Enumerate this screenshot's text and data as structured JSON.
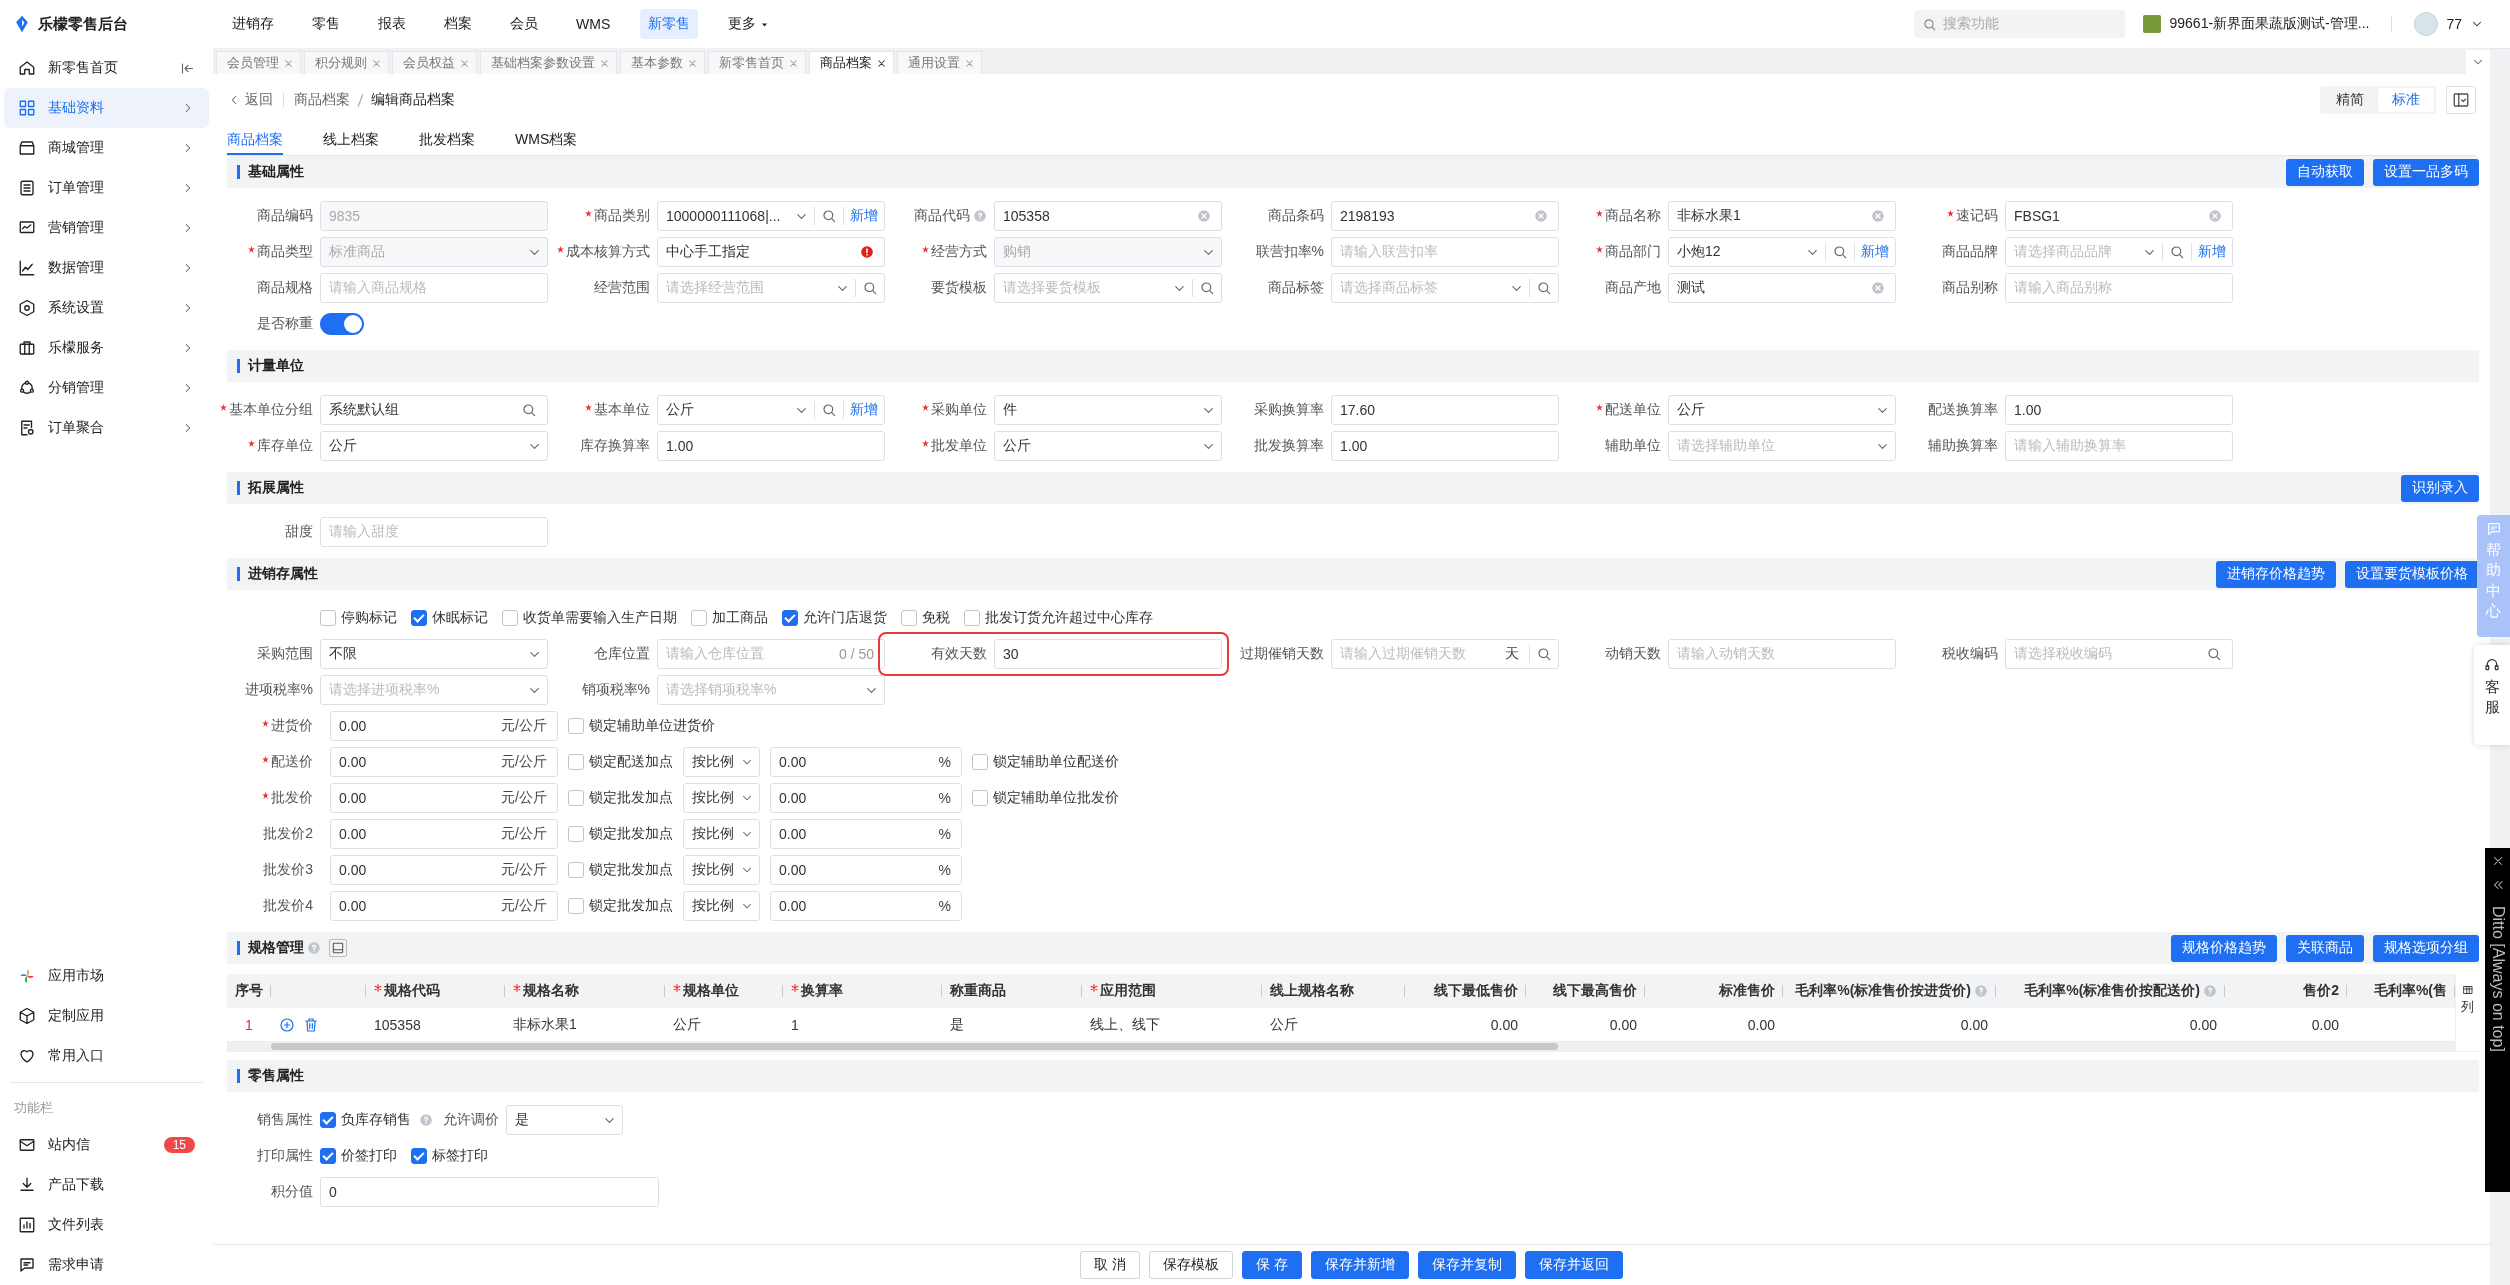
{
  "topbar": {
    "app_title": "乐檬零售后台",
    "nav": [
      {
        "label": "进销存",
        "selected": false
      },
      {
        "label": "零售",
        "selected": false
      },
      {
        "label": "报表",
        "selected": false
      },
      {
        "label": "档案",
        "selected": false
      },
      {
        "label": "会员",
        "selected": false
      },
      {
        "label": "WMS",
        "selected": false
      },
      {
        "label": "新零售",
        "selected": true
      },
      {
        "label": "更多",
        "selected": false,
        "caret": true
      }
    ],
    "search": {
      "placeholder": "搜索功能"
    },
    "store": "99661-新界面果蔬版测试-管理...",
    "user": "77"
  },
  "sidebar": {
    "items": [
      {
        "label": "新零售首页",
        "selected": false
      },
      {
        "label": "基础资料",
        "selected": true
      },
      {
        "label": "商城管理",
        "selected": false
      },
      {
        "label": "订单管理",
        "selected": false
      },
      {
        "label": "营销管理",
        "selected": false
      },
      {
        "label": "数据管理",
        "selected": false
      },
      {
        "label": "系统设置",
        "selected": false
      },
      {
        "label": "乐檬服务",
        "selected": false
      },
      {
        "label": "分销管理",
        "selected": false
      },
      {
        "label": "订单聚合",
        "selected": false
      }
    ],
    "apps": [
      {
        "label": "应用市场"
      },
      {
        "label": "定制应用"
      },
      {
        "label": "常用入口"
      }
    ],
    "function_bar": {
      "title": "功能栏",
      "items": [
        {
          "label": "站内信",
          "badge": "15"
        },
        {
          "label": "产品下载"
        },
        {
          "label": "文件列表"
        },
        {
          "label": "需求申请"
        }
      ]
    }
  },
  "page_tabs": [
    {
      "label": "会员管理",
      "selected": false
    },
    {
      "label": "积分规则",
      "selected": false
    },
    {
      "label": "会员权益",
      "selected": false
    },
    {
      "label": "基础档案参数设置",
      "selected": false
    },
    {
      "label": "基本参数",
      "selected": false
    },
    {
      "label": "新零售首页",
      "selected": false
    },
    {
      "label": "商品档案",
      "selected": true
    },
    {
      "label": "通用设置",
      "selected": false
    }
  ],
  "header": {
    "back": "返回",
    "breadcrumb": [
      "商品档案",
      "编辑商品档案"
    ],
    "views": [
      {
        "label": "精简",
        "selected": false
      },
      {
        "label": "标准",
        "selected": true
      }
    ],
    "tabs": [
      {
        "label": "商品档案",
        "selected": true
      },
      {
        "label": "线上档案",
        "selected": false
      },
      {
        "label": "批发档案",
        "selected": false
      },
      {
        "label": "WMS档案",
        "selected": false
      }
    ]
  },
  "sections": [
    {
      "title": "基础属性",
      "kind": "form",
      "buttons": [
        "自动获取",
        "设置一品多码"
      ],
      "rows": [
        {
          "kind": "grid",
          "fields": [
            {
              "label": "商品编码",
              "required": false,
              "kind": "input",
              "value": "9835",
              "disabled": true
            },
            {
              "label": "商品类别",
              "required": true,
              "kind": "select",
              "value": "1000000111068|...",
              "disabled": false,
              "search_button": true,
              "add": "新增"
            },
            {
              "label": "商品代码",
              "required": false,
              "help": true,
              "kind": "input",
              "value": "105358",
              "disabled": false,
              "clearable": true
            },
            {
              "label": "商品条码",
              "required": false,
              "kind": "input",
              "value": "2198193",
              "disabled": false,
              "clearable": true
            },
            {
              "label": "商品名称",
              "required": true,
              "kind": "input",
              "value": "非标水果1",
              "disabled": false,
              "clearable": true
            },
            {
              "label": "速记码",
              "required": true,
              "kind": "input",
              "value": "FBSG1",
              "disabled": false,
              "clearable": true
            }
          ]
        },
        {
          "kind": "grid",
          "fields": [
            {
              "label": "商品类型",
              "required": true,
              "kind": "select",
              "value": "标准商品",
              "disabled": true
            },
            {
              "label": "成本核算方式",
              "required": true,
              "kind": "input",
              "value": "中心手工指定",
              "disabled": false,
              "error": true
            },
            {
              "label": "经营方式",
              "required": true,
              "kind": "select",
              "value": "购销",
              "disabled": true
            },
            {
              "label": "联营扣率%",
              "required": false,
              "kind": "input",
              "placeholder": "请输入联营扣率",
              "disabled": false
            },
            {
              "label": "商品部门",
              "required": true,
              "kind": "select",
              "value": "小炮12",
              "disabled": false,
              "search_button": true,
              "add": "新增"
            },
            {
              "label": "商品品牌",
              "required": false,
              "kind": "select",
              "placeholder": "请选择商品品牌",
              "disabled": false,
              "search_button": true,
              "add": "新增"
            }
          ]
        },
        {
          "kind": "grid",
          "fields": [
            {
              "label": "商品规格",
              "required": false,
              "kind": "input",
              "placeholder": "请输入商品规格",
              "disabled": false
            },
            {
              "label": "经营范围",
              "required": false,
              "kind": "select",
              "placeholder": "请选择经营范围",
              "disabled": false,
              "search_button": true
            },
            {
              "label": "要货模板",
              "required": false,
              "kind": "select",
              "placeholder": "请选择要货模板",
              "disabled": false,
              "search_button": true
            },
            {
              "label": "商品标签",
              "required": false,
              "kind": "select",
              "placeholder": "请选择商品标签",
              "disabled": false,
              "search_button": true
            },
            {
              "label": "商品产地",
              "required": false,
              "kind": "input",
              "value": "测试",
              "disabled": false,
              "clearable": true
            },
            {
              "label": "商品别称",
              "required": false,
              "kind": "input",
              "placeholder": "请输入商品别称",
              "disabled": false
            }
          ]
        },
        {
          "kind": "grid",
          "fields": [
            {
              "label": "是否称重",
              "required": false,
              "kind": "toggle",
              "on": true
            }
          ]
        }
      ]
    },
    {
      "title": "计量单位",
      "kind": "form",
      "rows": [
        {
          "kind": "grid",
          "fields": [
            {
              "label": "基本单位分组",
              "required": true,
              "kind": "lookup",
              "value": "系统默认组",
              "disabled": false
            },
            {
              "label": "基本单位",
              "required": true,
              "kind": "select",
              "value": "公斤",
              "disabled": false,
              "search_button": true,
              "add": "新增"
            },
            {
              "label": "采购单位",
              "required": true,
              "kind": "select",
              "value": "件",
              "disabled": false
            },
            {
              "label": "采购换算率",
              "required": false,
              "kind": "input",
              "value": "17.60",
              "disabled": false
            },
            {
              "label": "配送单位",
              "required": true,
              "kind": "select",
              "value": "公斤",
              "disabled": false
            },
            {
              "label": "配送换算率",
              "required": false,
              "kind": "input",
              "value": "1.00",
              "disabled": false
            }
          ]
        },
        {
          "kind": "grid",
          "fields": [
            {
              "label": "库存单位",
              "required": true,
              "kind": "select",
              "value": "公斤",
              "disabled": false
            },
            {
              "label": "库存换算率",
              "required": false,
              "kind": "input",
              "value": "1.00",
              "disabled": false
            },
            {
              "label": "批发单位",
              "required": true,
              "kind": "select",
              "value": "公斤",
              "disabled": false
            },
            {
              "label": "批发换算率",
              "required": false,
              "kind": "input",
              "value": "1.00",
              "disabled": false
            },
            {
              "label": "辅助单位",
              "required": false,
              "kind": "select",
              "placeholder": "请选择辅助单位",
              "disabled": false
            },
            {
              "label": "辅助换算率",
              "required": false,
              "kind": "input",
              "placeholder": "请输入辅助换算率",
              "disabled": false
            }
          ]
        }
      ]
    },
    {
      "title": "拓展属性",
      "kind": "form",
      "buttons": [
        "识别录入"
      ],
      "rows": [
        {
          "kind": "grid",
          "fields": [
            {
              "label": "甜度",
              "required": false,
              "kind": "input",
              "placeholder": "请输入甜度",
              "disabled": false
            }
          ]
        }
      ]
    },
    {
      "title": "进销存属性",
      "kind": "form",
      "buttons": [
        "进销存价格趋势",
        "设置要货模板价格"
      ],
      "rows": [
        {
          "kind": "inline",
          "fields": [
            {
              "kind": "checks",
              "items": [
                {
                  "label": "停购标记",
                  "checked": false
                },
                {
                  "label": "休眠标记",
                  "checked": true
                },
                {
                  "label": "收货单需要输入生产日期",
                  "checked": false
                },
                {
                  "label": "加工商品",
                  "checked": false
                },
                {
                  "label": "允许门店退货",
                  "checked": true
                },
                {
                  "label": "免税",
                  "checked": false
                },
                {
                  "label": "批发订货允许超过中心库存",
                  "checked": false
                }
              ]
            }
          ]
        },
        {
          "kind": "grid",
          "fields": [
            {
              "label": "采购范围",
              "required": false,
              "kind": "select",
              "value": "不限",
              "disabled": false
            },
            {
              "label": "仓库位置",
              "required": false,
              "kind": "input",
              "placeholder": "请输入仓库位置",
              "counter": "0 / 50",
              "disabled": false
            },
            {
              "label": "有效天数",
              "required": false,
              "kind": "input",
              "value": "30",
              "disabled": false,
              "highlighted": true
            },
            {
              "label": "过期催销天数",
              "required": false,
              "kind": "input",
              "placeholder": "请输入过期催销天数",
              "suffix": "天",
              "search_button": true,
              "disabled": false
            },
            {
              "label": "动销天数",
              "required": false,
              "kind": "input",
              "placeholder": "请输入动销天数",
              "disabled": false
            },
            {
              "label": "税收编码",
              "required": false,
              "kind": "lookup",
              "placeholder": "请选择税收编码",
              "disabled": false
            }
          ]
        },
        {
          "kind": "grid",
          "fields": [
            {
              "label": "进项税率%",
              "required": false,
              "kind": "select",
              "placeholder": "请选择进项税率%",
              "disabled": false
            },
            {
              "label": "销项税率%",
              "required": false,
              "kind": "select",
              "placeholder": "请选择销项税率%",
              "disabled": false
            }
          ]
        }
      ],
      "prices": [
        {
          "label": "进货价",
          "required": true,
          "value": "0.00",
          "unit": "元/公斤",
          "lock": {
            "label": "锁定辅助单位进货价",
            "checked": false
          }
        },
        {
          "label": "配送价",
          "required": true,
          "value": "0.00",
          "unit": "元/公斤",
          "lock": {
            "label": "锁定配送加点",
            "checked": false
          },
          "markup": {
            "mode": "按比例",
            "value": "0.00",
            "suffix": "%"
          },
          "aux_lock": {
            "label": "锁定辅助单位配送价",
            "checked": false
          }
        },
        {
          "label": "批发价",
          "required": true,
          "value": "0.00",
          "unit": "元/公斤",
          "lock": {
            "label": "锁定批发加点",
            "checked": false
          },
          "markup": {
            "mode": "按比例",
            "value": "0.00",
            "suffix": "%"
          },
          "aux_lock": {
            "label": "锁定辅助单位批发价",
            "checked": false
          }
        },
        {
          "label": "批发价2",
          "required": false,
          "value": "0.00",
          "unit": "元/公斤",
          "lock": {
            "label": "锁定批发加点",
            "checked": false
          },
          "markup": {
            "mode": "按比例",
            "value": "0.00",
            "suffix": "%"
          }
        },
        {
          "label": "批发价3",
          "required": false,
          "value": "0.00",
          "unit": "元/公斤",
          "lock": {
            "label": "锁定批发加点",
            "checked": false
          },
          "markup": {
            "mode": "按比例",
            "value": "0.00",
            "suffix": "%"
          }
        },
        {
          "label": "批发价4",
          "required": false,
          "value": "0.00",
          "unit": "元/公斤",
          "lock": {
            "label": "锁定批发加点",
            "checked": false
          },
          "markup": {
            "mode": "按比例",
            "value": "0.00",
            "suffix": "%"
          }
        }
      ]
    },
    {
      "title": "规格管理",
      "kind": "table",
      "help": true,
      "buttons": [
        "规格价格趋势",
        "关联商品",
        "规格选项分组"
      ],
      "table": {
        "columns": [
          {
            "label": "序号",
            "required": false
          },
          {
            "kind": "actions"
          },
          {
            "label": "规格代码",
            "required": true
          },
          {
            "label": "规格名称",
            "required": true
          },
          {
            "label": "规格单位",
            "required": true
          },
          {
            "label": "换算率",
            "required": true
          },
          {
            "label": "称重商品",
            "required": false
          },
          {
            "label": "应用范围",
            "required": true
          },
          {
            "label": "线上规格名称",
            "required": false
          },
          {
            "label": "线下最低售价",
            "required": false
          },
          {
            "label": "线下最高售价",
            "required": false
          },
          {
            "label": "标准售价",
            "required": false
          },
          {
            "label": "毛利率%(标准售价按进货价)",
            "required": false,
            "help": true
          },
          {
            "label": "毛利率%(标准售价按配送价)",
            "required": false,
            "help": true
          },
          {
            "label": "售价2",
            "required": false
          },
          {
            "label": "毛利率%(售",
            "required": false
          }
        ],
        "rows": [
          {
            "cells": [
              "1",
              null,
              "105358",
              "非标水果1",
              "公斤",
              "1",
              "是",
              "线上、线下",
              "公斤",
              "0.00",
              "0.00",
              "0.00",
              "0.00",
              "0.00",
              "0.00"
            ]
          }
        ],
        "column_settings": "列"
      }
    },
    {
      "title": "零售属性",
      "kind": "form",
      "rows": [
        {
          "kind": "inline",
          "fields": [
            {
              "label": "销售属性",
              "required": false,
              "kind": "checks",
              "items": [
                {
                  "label": "负库存销售",
                  "checked": true,
                  "help": true
                }
              ]
            },
            {
              "label": "允许调价",
              "required": false,
              "kind": "select",
              "value": "是",
              "disabled": false
            }
          ]
        },
        {
          "kind": "inline",
          "fields": [
            {
              "label": "打印属性",
              "required": false,
              "kind": "checks",
              "items": [
                {
                  "label": "价签打印",
                  "checked": true
                },
                {
                  "label": "标签打印",
                  "checked": true
                }
              ]
            }
          ]
        },
        {
          "kind": "inline",
          "fields": [
            {
              "label": "积分值",
              "required": false,
              "kind": "input",
              "value": "0",
              "disabled": false
            }
          ]
        }
      ]
    }
  ],
  "footer": {
    "buttons": [
      {
        "label": "取 消",
        "kind": "default"
      },
      {
        "label": "保存模板",
        "kind": "default"
      },
      {
        "label": "保 存",
        "kind": "primary"
      },
      {
        "label": "保存并新增",
        "kind": "primary"
      },
      {
        "label": "保存并复制",
        "kind": "primary"
      },
      {
        "label": "保存并返回",
        "kind": "primary"
      }
    ]
  },
  "floaters": {
    "help_center": "帮助中心",
    "service": "客服",
    "ditto": "Ditto [Always on top]"
  }
}
